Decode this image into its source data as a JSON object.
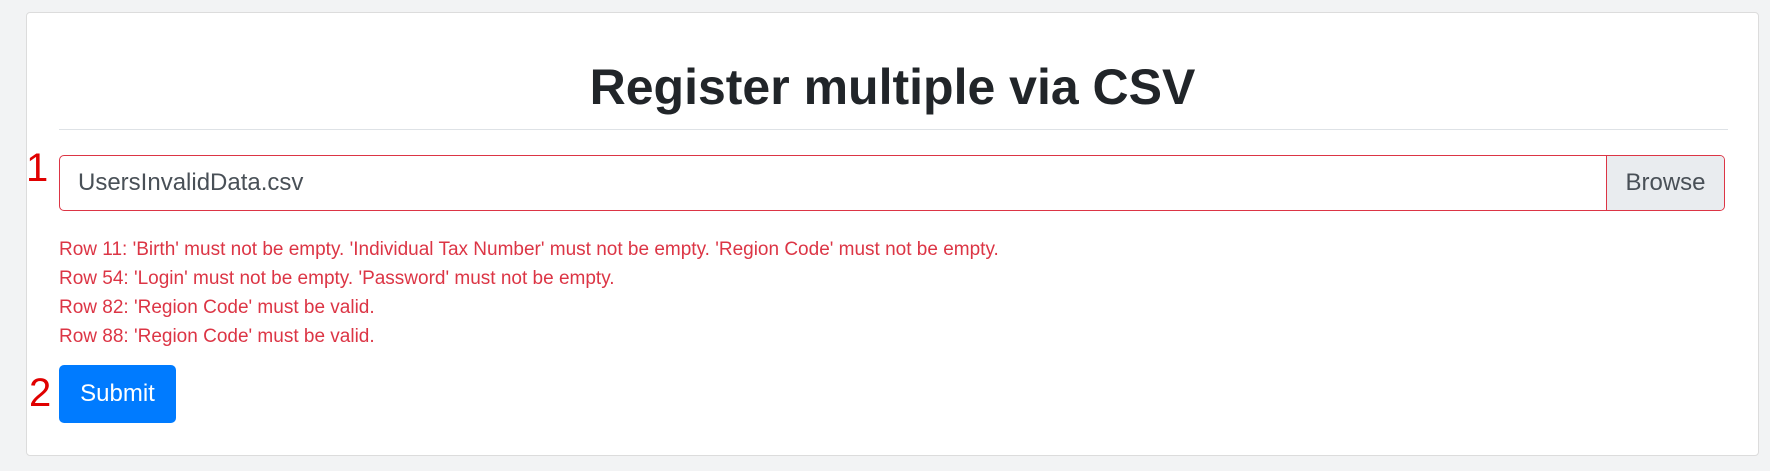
{
  "page": {
    "title": "Register multiple via CSV"
  },
  "markers": {
    "file": "1",
    "submit": "2"
  },
  "file_input": {
    "value": "UsersInvalidData.csv",
    "browse_label": "Browse"
  },
  "errors": [
    "Row 11: 'Birth' must not be empty. 'Individual Tax Number' must not be empty. 'Region Code' must not be empty.",
    "Row 54: 'Login' must not be empty. 'Password' must not be empty.",
    "Row 82: 'Region Code' must be valid.",
    "Row 88: 'Region Code' must be valid."
  ],
  "actions": {
    "submit_label": "Submit"
  },
  "colors": {
    "error": "#dc3545",
    "primary": "#007bff",
    "marker": "#e00000"
  }
}
